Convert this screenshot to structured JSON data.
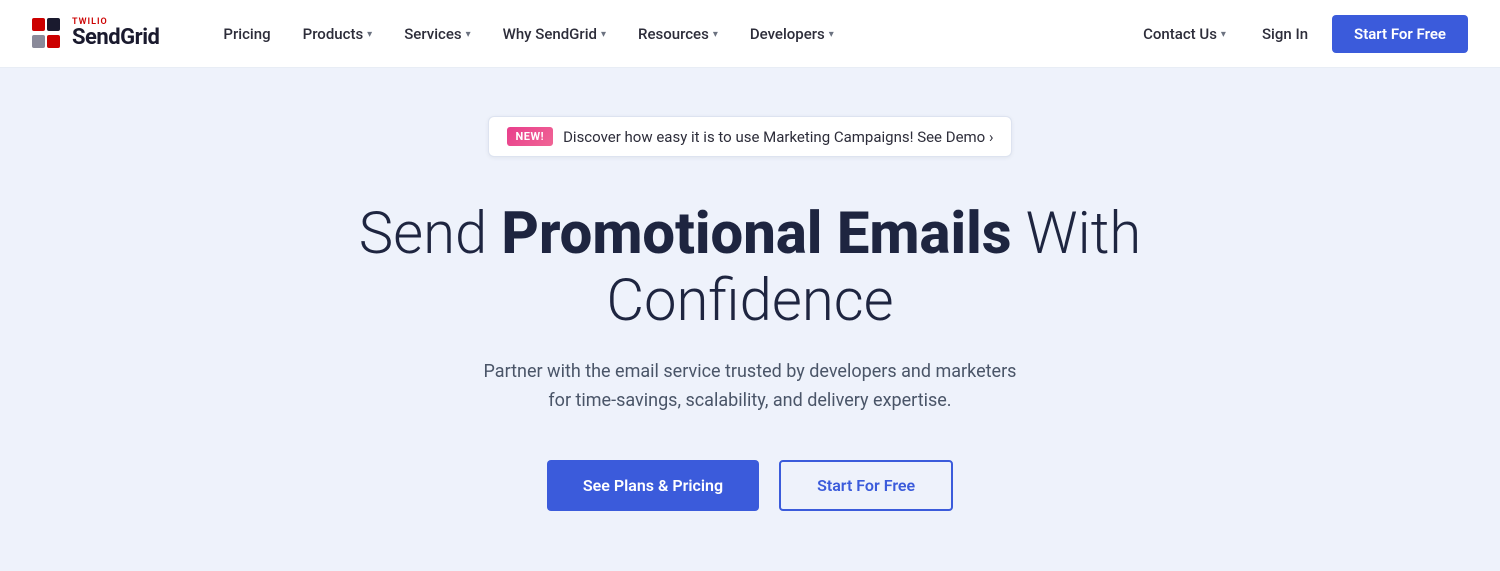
{
  "logo": {
    "twilio_label": "TWILIO",
    "sendgrid_label": "SendGrid"
  },
  "nav": {
    "pricing_label": "Pricing",
    "products_label": "Products",
    "services_label": "Services",
    "why_label": "Why SendGrid",
    "resources_label": "Resources",
    "developers_label": "Developers",
    "contact_label": "Contact Us",
    "signin_label": "Sign In",
    "cta_label": "Start For Free"
  },
  "hero": {
    "badge_label": "NEW!",
    "banner_text": "Discover how easy it is to use Marketing Campaigns! See Demo ›",
    "headline_part1": "Send ",
    "headline_bold": "Promotional Emails",
    "headline_part2": " With Confidence",
    "subtext": "Partner with the email service trusted by developers and marketers for time-savings, scalability, and delivery expertise.",
    "btn_primary_label": "See Plans & Pricing",
    "btn_secondary_label": "Start For Free"
  }
}
